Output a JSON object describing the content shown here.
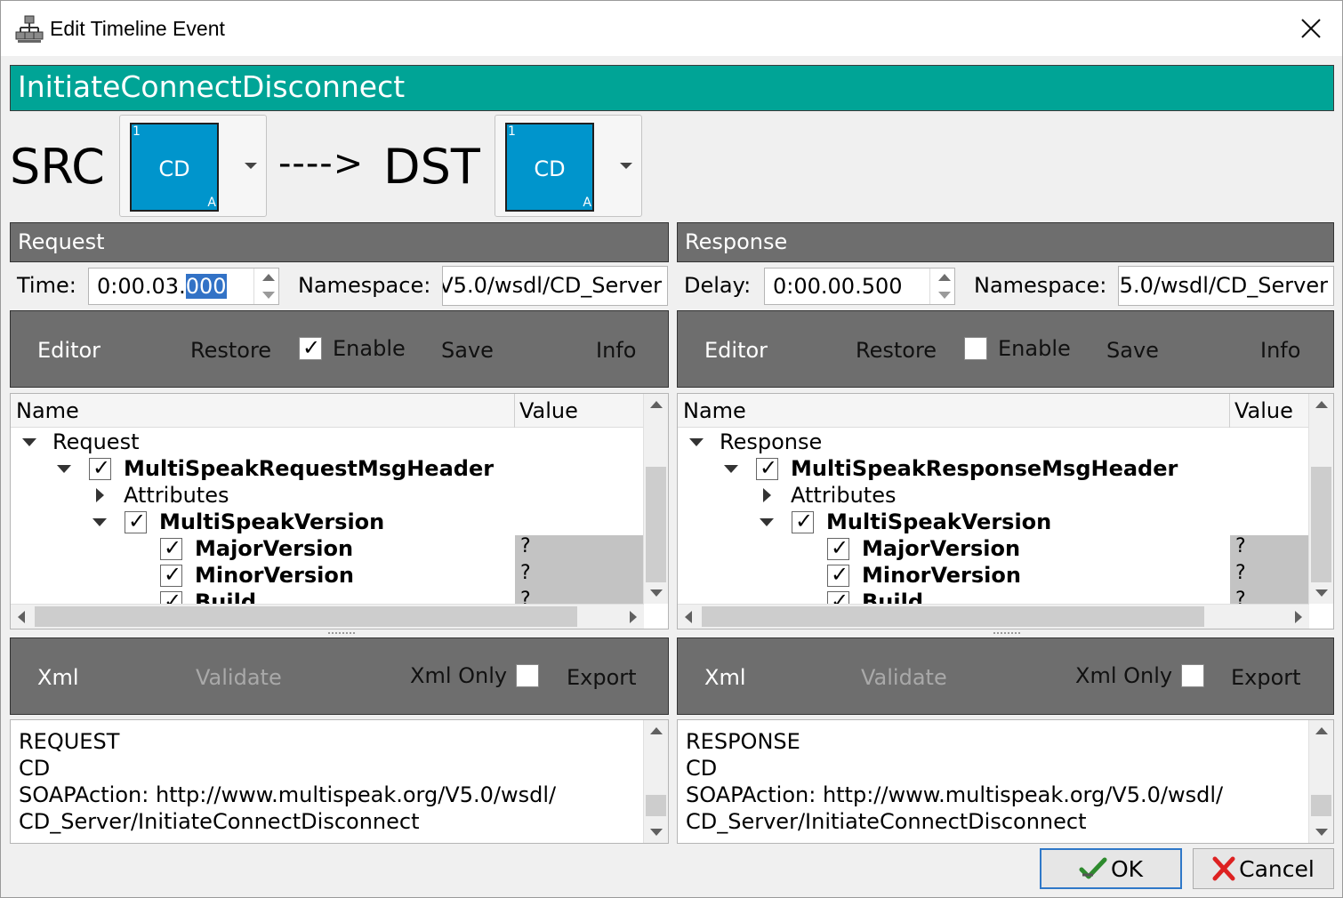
{
  "window": {
    "title": "Edit Timeline Event",
    "icon": "network-nodes-icon",
    "close_icon": "close-icon"
  },
  "event_name": "InitiateConnectDisconnect",
  "src": {
    "label": "SRC",
    "tile": {
      "number": "1",
      "code": "CD",
      "sub": "A",
      "color": "#0095cc"
    }
  },
  "arrow": "---->",
  "dst": {
    "label": "DST",
    "tile": {
      "number": "1",
      "code": "CD",
      "sub": "A",
      "color": "#0095cc"
    }
  },
  "request": {
    "header": "Request",
    "time_label": "Time:",
    "time_value_prefix": "0:00.03.",
    "time_value_selected": "000",
    "namespace_label": "Namespace:",
    "namespace_value": "V5.0/wsdl/CD_Server",
    "toolbar": {
      "editor": "Editor",
      "restore": "Restore",
      "enable": "Enable",
      "enable_checked": true,
      "save": "Save",
      "info": "Info"
    },
    "tree": {
      "col_name": "Name",
      "col_value": "Value",
      "rows": [
        {
          "label": "Request",
          "bold": false,
          "expander": "down",
          "checkbox": false,
          "value": ""
        },
        {
          "label": "MultiSpeakRequestMsgHeader",
          "bold": true,
          "expander": "down",
          "checkbox": true,
          "value": ""
        },
        {
          "label": "Attributes",
          "bold": false,
          "expander": "right",
          "checkbox": false,
          "value": ""
        },
        {
          "label": "MultiSpeakVersion",
          "bold": true,
          "expander": "down",
          "checkbox": true,
          "value": ""
        },
        {
          "label": "MajorVersion",
          "bold": true,
          "expander": "none",
          "checkbox": true,
          "value": "?"
        },
        {
          "label": "MinorVersion",
          "bold": true,
          "expander": "none",
          "checkbox": true,
          "value": "?"
        },
        {
          "label": "Build",
          "bold": true,
          "expander": "none",
          "checkbox": true,
          "value": "?"
        }
      ]
    },
    "xml_toolbar": {
      "xml": "Xml",
      "validate": "Validate",
      "xml_only": "Xml Only",
      "xml_only_checked": false,
      "export": "Export"
    },
    "xml_lines": [
      "REQUEST",
      "CD",
      "SOAPAction: http://www.multispeak.org/V5.0/wsdl/",
      "CD_Server/InitiateConnectDisconnect"
    ]
  },
  "response": {
    "header": "Response",
    "delay_label": "Delay:",
    "delay_value": "0:00.00.500",
    "namespace_label": "Namespace:",
    "namespace_value": "5.0/wsdl/CD_Server",
    "toolbar": {
      "editor": "Editor",
      "restore": "Restore",
      "enable": "Enable",
      "enable_checked": false,
      "save": "Save",
      "info": "Info"
    },
    "tree": {
      "col_name": "Name",
      "col_value": "Value",
      "rows": [
        {
          "label": "Response",
          "bold": false,
          "expander": "down",
          "checkbox": false,
          "value": ""
        },
        {
          "label": "MultiSpeakResponseMsgHeader",
          "bold": true,
          "expander": "down",
          "checkbox": true,
          "value": ""
        },
        {
          "label": "Attributes",
          "bold": false,
          "expander": "right",
          "checkbox": false,
          "value": ""
        },
        {
          "label": "MultiSpeakVersion",
          "bold": true,
          "expander": "down",
          "checkbox": true,
          "value": ""
        },
        {
          "label": "MajorVersion",
          "bold": true,
          "expander": "none",
          "checkbox": true,
          "value": "?"
        },
        {
          "label": "MinorVersion",
          "bold": true,
          "expander": "none",
          "checkbox": true,
          "value": "?"
        },
        {
          "label": "Build",
          "bold": true,
          "expander": "none",
          "checkbox": true,
          "value": "?"
        }
      ]
    },
    "xml_toolbar": {
      "xml": "Xml",
      "validate": "Validate",
      "xml_only": "Xml Only",
      "xml_only_checked": false,
      "export": "Export"
    },
    "xml_lines": [
      "RESPONSE",
      "CD",
      "SOAPAction: http://www.multispeak.org/V5.0/wsdl/",
      "CD_Server/InitiateConnectDisconnect"
    ]
  },
  "buttons": {
    "ok": {
      "label": "OK",
      "icon": "green-check-arrow-icon"
    },
    "cancel": {
      "label": "Cancel",
      "icon": "red-x-icon"
    }
  },
  "colors": {
    "event_bar": "#00a496",
    "toolbar": "#6e6e6e",
    "tile": "#0095cc",
    "value_cell": "#c3c3c3"
  }
}
